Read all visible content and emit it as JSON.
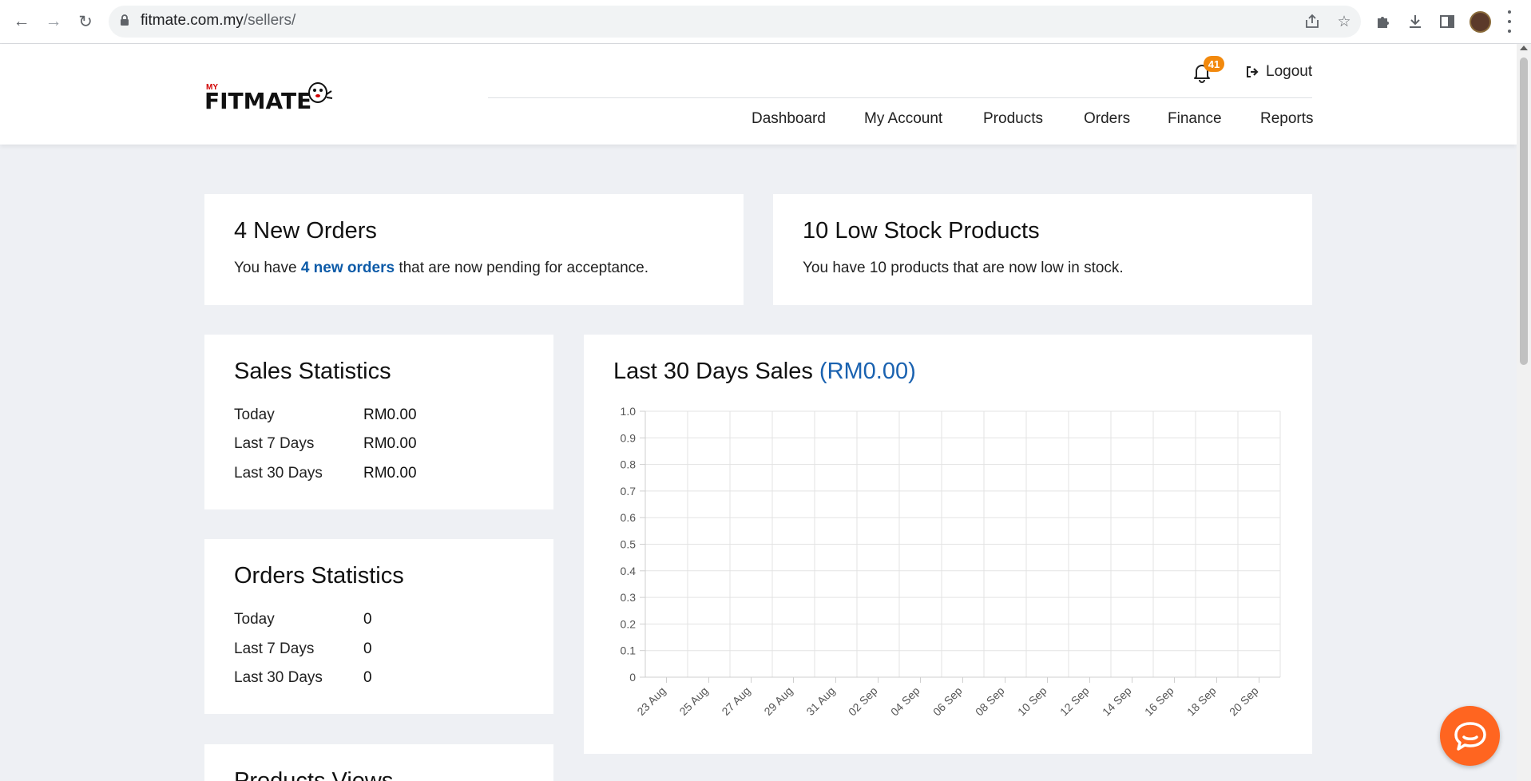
{
  "browser": {
    "url_host": "fitmate.com.my",
    "url_path": "/sellers/",
    "icons": [
      "back-icon",
      "forward-icon",
      "reload-icon",
      "lock-icon",
      "share-icon",
      "star-icon",
      "extensions-icon",
      "download-icon",
      "side-panel-icon",
      "profile-avatar",
      "menu-icon"
    ]
  },
  "header": {
    "logo_small": "MY",
    "logo_text": "FITMATE",
    "notification_count": "41",
    "logout_label": "Logout",
    "nav": [
      "Dashboard",
      "My Account",
      "Products",
      "Orders",
      "Finance",
      "Reports"
    ]
  },
  "new_orders": {
    "title": "4 New Orders",
    "text_before": "You have ",
    "link_text": "4 new orders",
    "text_after": " that are now pending for acceptance."
  },
  "low_stock": {
    "title": "10 Low Stock Products",
    "text": "You have 10 products that are now low in stock."
  },
  "sales_stats": {
    "title": "Sales Statistics",
    "rows": [
      {
        "label": "Today",
        "value": "RM0.00"
      },
      {
        "label": "Last 7 Days",
        "value": "RM0.00"
      },
      {
        "label": "Last 30 Days",
        "value": "RM0.00"
      }
    ]
  },
  "orders_stats": {
    "title": "Orders Statistics",
    "rows": [
      {
        "label": "Today",
        "value": "0"
      },
      {
        "label": "Last 7 Days",
        "value": "0"
      },
      {
        "label": "Last 30 Days",
        "value": "0"
      }
    ]
  },
  "product_views": {
    "title": "Products Views"
  },
  "sales_chart": {
    "title": "Last 30 Days Sales",
    "total": "(RM0.00)"
  },
  "chart_data": {
    "type": "line",
    "title": "Last 30 Days Sales (RM0.00)",
    "x": [
      "23 Aug",
      "25 Aug",
      "27 Aug",
      "29 Aug",
      "31 Aug",
      "02 Sep",
      "04 Sep",
      "06 Sep",
      "08 Sep",
      "10 Sep",
      "12 Sep",
      "14 Sep",
      "16 Sep",
      "18 Sep",
      "20 Sep"
    ],
    "yticks": [
      "0",
      "0.1",
      "0.2",
      "0.3",
      "0.4",
      "0.5",
      "0.6",
      "0.7",
      "0.8",
      "0.9",
      "1.0"
    ],
    "series": [],
    "ylim": [
      0,
      1.0
    ],
    "grid": true,
    "xlabel": "",
    "ylabel": ""
  },
  "colors": {
    "accent": "#1a62b0",
    "badge": "#f2890d",
    "chat": "#ff6520",
    "background": "#eef0f4"
  }
}
